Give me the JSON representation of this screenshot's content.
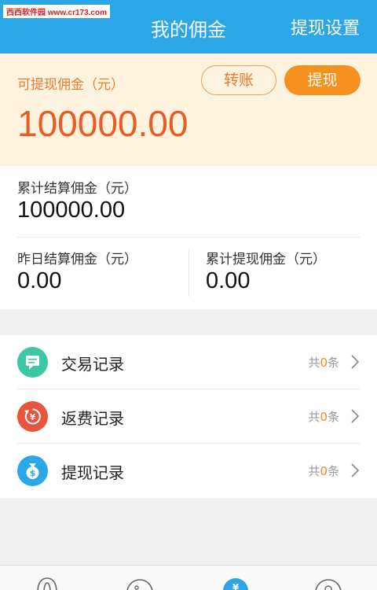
{
  "watermark": "西西软件园 www.cr173.com",
  "header": {
    "title": "我的佣金",
    "action": "提现设置"
  },
  "balance": {
    "label": "可提现佣金（元）",
    "amount": "100000.00",
    "transfer_label": "转账",
    "withdraw_label": "提现"
  },
  "stats": {
    "total_settled_label": "累计结算佣金（元）",
    "total_settled_value": "100000.00",
    "yesterday_label": "昨日结算佣金（元）",
    "yesterday_value": "0.00",
    "total_withdrawn_label": "累计提现佣金（元）",
    "total_withdrawn_value": "0.00"
  },
  "records": [
    {
      "label": "交易记录",
      "count_prefix": "共",
      "count": "0",
      "count_suffix": "条",
      "icon": "chat-icon",
      "color": "#3cc8a4"
    },
    {
      "label": "返费记录",
      "count_prefix": "共",
      "count": "0",
      "count_suffix": "条",
      "icon": "refund-yen-icon",
      "color": "#e8553e"
    },
    {
      "label": "提现记录",
      "count_prefix": "共",
      "count": "0",
      "count_suffix": "条",
      "icon": "money-bag-icon",
      "color": "#2ba6e6"
    }
  ],
  "colors": {
    "primary": "#2ba6e6",
    "accent": "#f5911e",
    "amount": "#ea5c23"
  }
}
